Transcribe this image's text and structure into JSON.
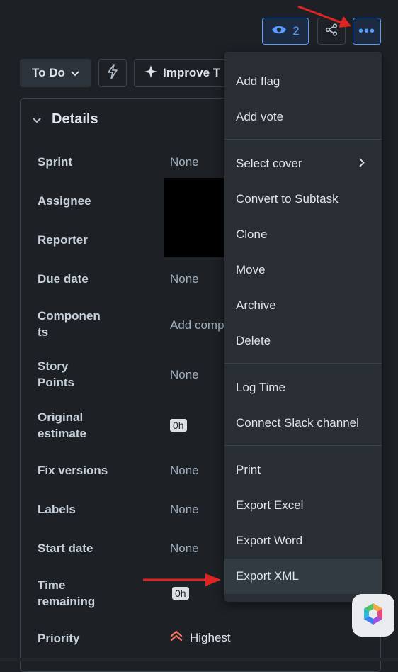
{
  "header": {
    "watchers_count": "2",
    "more_label": "•••"
  },
  "status_bar": {
    "status_label": "To Do",
    "improve_label": "Improve T"
  },
  "details": {
    "title": "Details",
    "fields": {
      "sprint": {
        "label": "Sprint",
        "value": "None"
      },
      "assignee": {
        "label": "Assignee"
      },
      "reporter": {
        "label": "Reporter"
      },
      "due_date": {
        "label": "Due date",
        "value": "None"
      },
      "components": {
        "label_line1": "Componen",
        "label_line2": "ts",
        "value": "Add comp"
      },
      "story_points": {
        "label_line1": "Story",
        "label_line2": "Points",
        "value": "None"
      },
      "original_estimate": {
        "label_line1": "Original",
        "label_line2": "estimate",
        "value": "0h"
      },
      "fix_versions": {
        "label": "Fix versions",
        "value": "None"
      },
      "labels": {
        "label": "Labels",
        "value": "None"
      },
      "start_date": {
        "label": "Start date",
        "value": "None"
      },
      "time_remaining": {
        "label_line1": "Time",
        "label_line2": "remaining",
        "value": "0h"
      },
      "priority": {
        "label": "Priority",
        "value": "Highest"
      }
    }
  },
  "menu": {
    "items": [
      {
        "label": "Add flag"
      },
      {
        "label": "Add vote"
      },
      {
        "label": "Select cover"
      },
      {
        "label": "Convert to Subtask"
      },
      {
        "label": "Clone"
      },
      {
        "label": "Move"
      },
      {
        "label": "Archive"
      },
      {
        "label": "Delete"
      },
      {
        "label": "Log Time"
      },
      {
        "label": "Connect Slack channel"
      },
      {
        "label": "Print"
      },
      {
        "label": "Export Excel"
      },
      {
        "label": "Export Word"
      },
      {
        "label": "Export XML"
      }
    ],
    "active_item": "Export XML"
  },
  "icons": {
    "watch": "eye-icon",
    "share": "share-icon",
    "more": "more-icon",
    "automation": "lightning-icon",
    "improve": "sparkle-icon",
    "collapse": "chevron-down-icon",
    "submenu": "chevron-right-icon",
    "priority": "highest-priority-icon",
    "fab": "app-logo-icon"
  },
  "colors": {
    "background": "#1d2125",
    "accent": "#579dff",
    "menu_bg": "#282e33",
    "priority": "#f87462",
    "annotation_arrow": "#e02424"
  }
}
